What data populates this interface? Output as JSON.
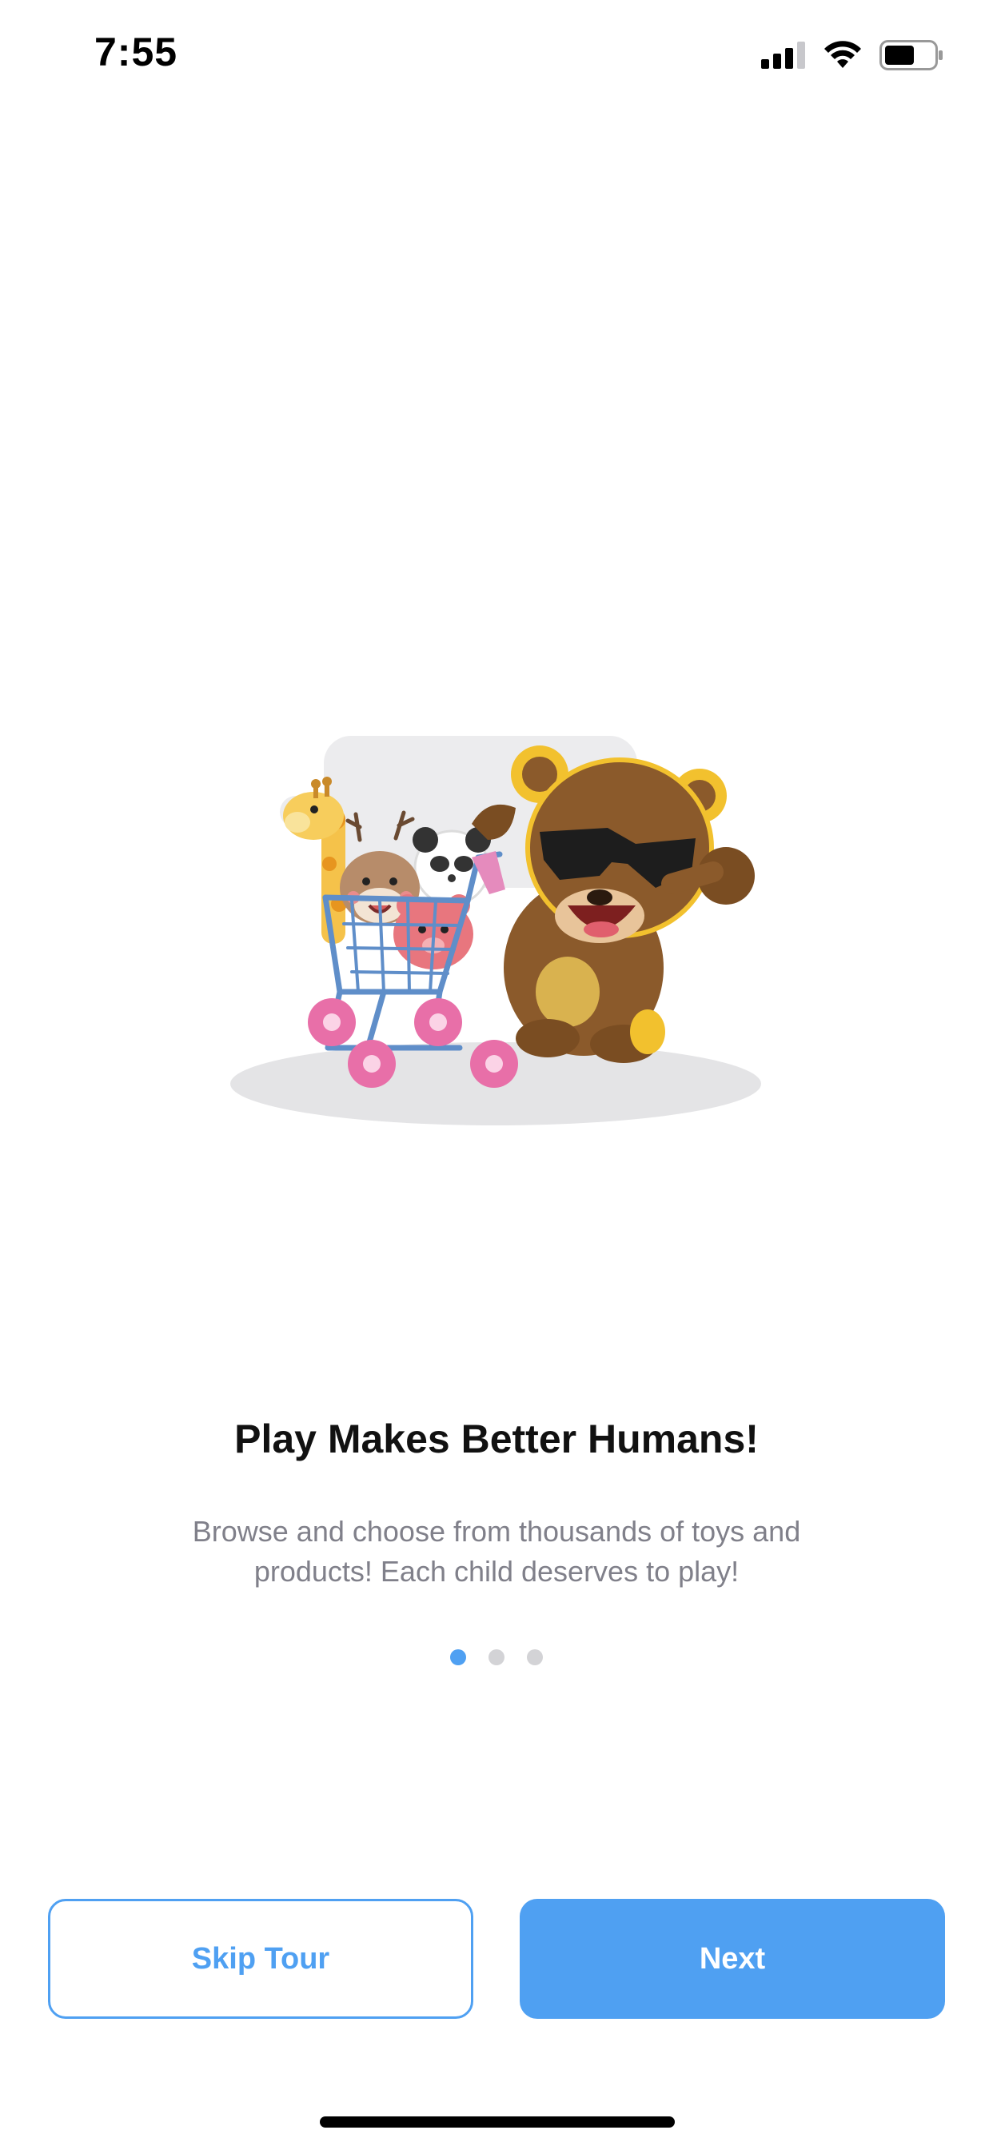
{
  "status_bar": {
    "time": "7:55",
    "icons": [
      "cellular-signal-icon",
      "wifi-icon",
      "battery-icon"
    ]
  },
  "onboarding": {
    "illustration": "bear-pushing-shopping-cart-of-toys",
    "title": "Play Makes Better Humans!",
    "subtitle": "Browse and choose from thousands of toys and products! Each child deserves to play!",
    "page_indicator": {
      "current": 1,
      "total": 3
    }
  },
  "actions": {
    "skip_label": "Skip Tour",
    "next_label": "Next"
  },
  "colors": {
    "accent": "#4fa0f2",
    "subtitle": "#80808a",
    "dot_inactive": "#d3d3d6"
  }
}
